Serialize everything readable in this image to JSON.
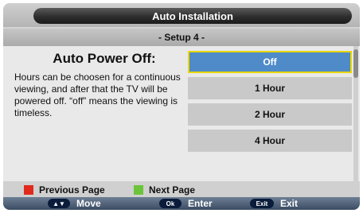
{
  "window": {
    "title": "Auto Installation"
  },
  "subtitle": "- Setup 4 -",
  "main": {
    "heading": "Auto Power Off:",
    "description": "Hours can be choosen for a continuous viewing, and after that the TV will be powered off. “off” means the viewing is timeless."
  },
  "options": [
    {
      "label": "Off",
      "selected": true
    },
    {
      "label": "1 Hour",
      "selected": false
    },
    {
      "label": "2 Hour",
      "selected": false
    },
    {
      "label": "4 Hour",
      "selected": false
    }
  ],
  "legend": {
    "previous": {
      "label": "Previous Page",
      "color": "#e02a1c"
    },
    "next": {
      "label": "Next Page",
      "color": "#6cc43a"
    }
  },
  "nav": {
    "move": {
      "key": "▲▼",
      "label": "Move"
    },
    "enter": {
      "key": "Ok",
      "label": "Enter"
    },
    "exit": {
      "key": "Exit",
      "label": "Exit"
    }
  },
  "colors": {
    "selected_fill": "#4f8ac9",
    "selected_border": "#e9d800"
  }
}
